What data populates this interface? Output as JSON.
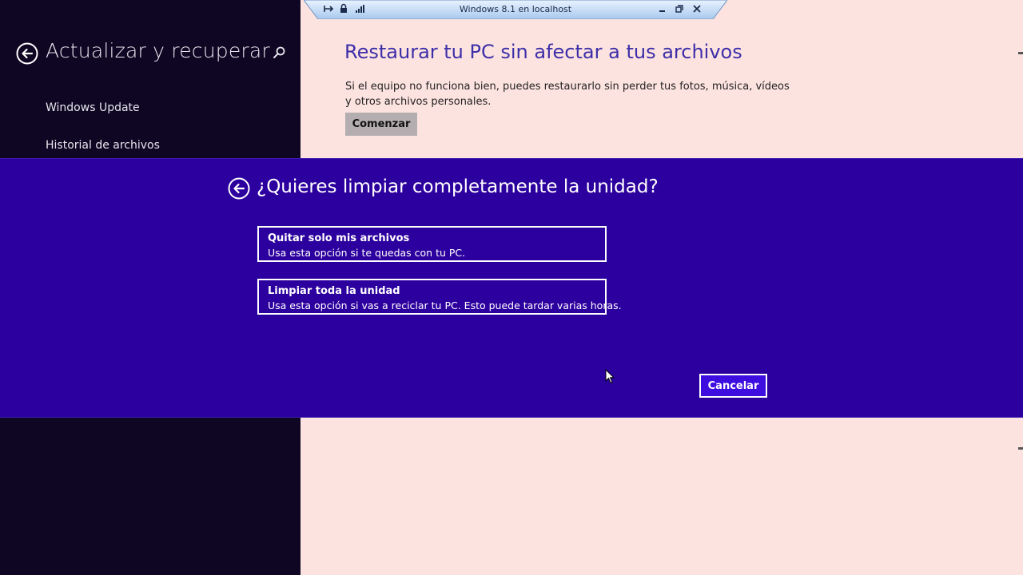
{
  "sidebar": {
    "title": "Actualizar y recuperar",
    "items": [
      {
        "label": "Windows Update"
      },
      {
        "label": "Historial de archivos"
      }
    ]
  },
  "remote_bar": {
    "title": "Windows 8.1 en localhost"
  },
  "main": {
    "title": "Restaurar tu PC sin afectar a tus archivos",
    "description": "Si el equipo no funciona bien, puedes restaurarlo sin perder tus fotos, música, vídeos y otros archivos personales.",
    "start_button": "Comenzar"
  },
  "dialog": {
    "heading": "¿Quieres limpiar completamente la unidad?",
    "options": [
      {
        "title": "Quitar solo mis archivos",
        "description": "Usa esta opción si te quedas con tu PC."
      },
      {
        "title": "Limpiar toda la unidad",
        "description": "Usa esta opción si vas a reciclar tu PC. Esto puede tardar varias horas."
      }
    ],
    "cancel_button": "Cancelar"
  },
  "colors": {
    "sidebar_bg": "#0f0623",
    "content_bg": "#fde3e0",
    "dialog_bg": "#2c009e",
    "title_accent": "#3d2fa8",
    "cancel_bg": "#3e0ee0"
  },
  "icons": [
    "back-arrow-icon",
    "search-icon",
    "pin-icon",
    "lock-icon",
    "signal-icon",
    "minimize-icon",
    "restore-icon",
    "close-icon",
    "mouse-cursor-icon"
  ]
}
